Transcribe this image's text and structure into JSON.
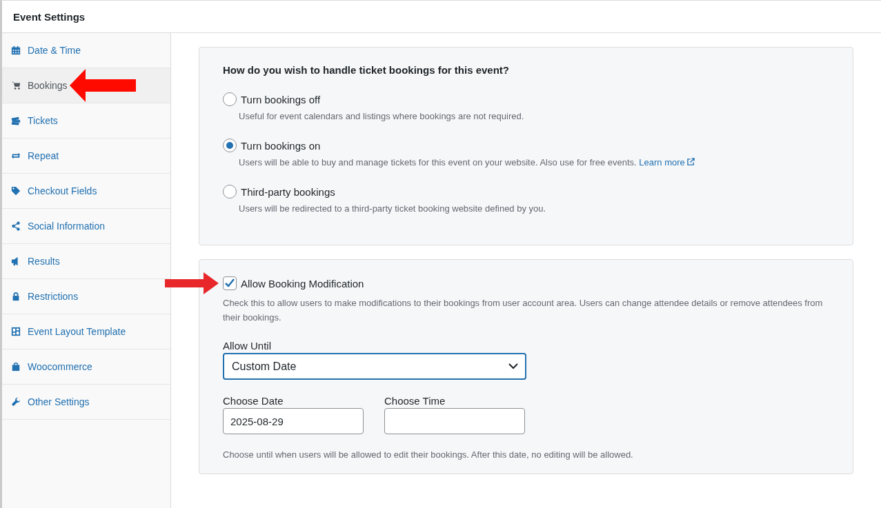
{
  "window": {
    "title": "Event Settings"
  },
  "sidebar": {
    "items": [
      {
        "label": "Date & Time",
        "selected": false
      },
      {
        "label": "Bookings",
        "selected": true
      },
      {
        "label": "Tickets",
        "selected": false
      },
      {
        "label": "Repeat",
        "selected": false
      },
      {
        "label": "Checkout Fields",
        "selected": false
      },
      {
        "label": "Social Information",
        "selected": false
      },
      {
        "label": "Results",
        "selected": false
      },
      {
        "label": "Restrictions",
        "selected": false
      },
      {
        "label": "Event Layout Template",
        "selected": false
      },
      {
        "label": "Woocommerce",
        "selected": false
      },
      {
        "label": "Other Settings",
        "selected": false
      }
    ]
  },
  "booking_mode": {
    "question": "How do you wish to handle ticket bookings for this event?",
    "options": [
      {
        "label": "Turn bookings off",
        "description": "Useful for event calendars and listings where bookings are not required.",
        "selected": false
      },
      {
        "label": "Turn bookings on",
        "description": "Users will be able to buy and manage tickets for this event on your website. Also use for free events.",
        "link": "Learn more",
        "selected": true
      },
      {
        "label": "Third-party bookings",
        "description": "Users will be redirected to a third-party ticket booking website defined by you.",
        "selected": false
      }
    ]
  },
  "modification": {
    "label": "Allow Booking Modification",
    "checked": true,
    "description": "Check this to allow users to make modifications to their bookings from user account area. Users can change attendee details or remove attendees from their bookings.",
    "allow_until": {
      "label": "Allow Until",
      "value": "Custom Date"
    },
    "choose_date": {
      "label": "Choose Date",
      "value": "2025-08-29"
    },
    "choose_time": {
      "label": "Choose Time"
    },
    "note": "Choose until when users will be allowed to edit their bookings. After this date, no editing will be allowed."
  }
}
